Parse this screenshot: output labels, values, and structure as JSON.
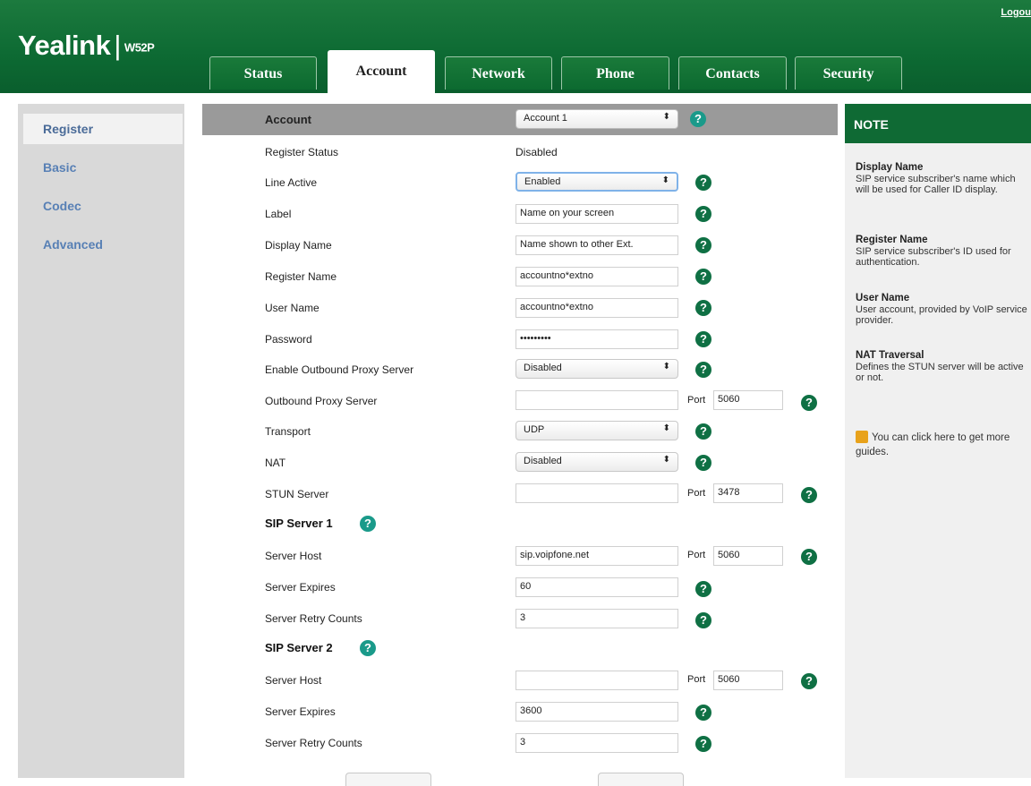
{
  "header": {
    "brand": "Yealink",
    "separator": "|",
    "model": "W52P",
    "logout": "Logou",
    "tabs": [
      {
        "label": "Status"
      },
      {
        "label": "Account"
      },
      {
        "label": "Network"
      },
      {
        "label": "Phone"
      },
      {
        "label": "Contacts"
      },
      {
        "label": "Security"
      }
    ],
    "active_tab": "Account"
  },
  "sidebar": {
    "items": [
      {
        "label": "Register"
      },
      {
        "label": "Basic"
      },
      {
        "label": "Codec"
      },
      {
        "label": "Advanced"
      }
    ],
    "active": "Register"
  },
  "form": {
    "account_label": "Account",
    "account_value": "Account 1",
    "register_status_label": "Register Status",
    "register_status_value": "Disabled",
    "line_active_label": "Line Active",
    "line_active_value": "Enabled",
    "label_label": "Label",
    "label_value": "Name on your screen",
    "display_name_label": "Display Name",
    "display_name_value": "Name shown to other Ext.",
    "register_name_label": "Register Name",
    "register_name_value": "accountno*extno",
    "user_name_label": "User Name",
    "user_name_value": "accountno*extno",
    "password_label": "Password",
    "password_value": "•••••••••",
    "outbound_enable_label": "Enable Outbound Proxy Server",
    "outbound_enable_value": "Disabled",
    "outbound_server_label": "Outbound Proxy Server",
    "outbound_server_value": "",
    "outbound_port": "5060",
    "transport_label": "Transport",
    "transport_value": "UDP",
    "nat_label": "NAT",
    "nat_value": "Disabled",
    "stun_label": "STUN Server",
    "stun_value": "",
    "stun_port": "3478",
    "port_label": "Port",
    "sip1": {
      "title": "SIP Server 1",
      "host_label": "Server Host",
      "host_value": "sip.voipfone.net",
      "port": "5060",
      "expires_label": "Server Expires",
      "expires_value": "60",
      "retry_label": "Server Retry Counts",
      "retry_value": "3"
    },
    "sip2": {
      "title": "SIP Server 2",
      "host_label": "Server Host",
      "host_value": "",
      "port": "5060",
      "expires_label": "Server Expires",
      "expires_value": "3600",
      "retry_label": "Server Retry Counts",
      "retry_value": "3"
    }
  },
  "note": {
    "header": "NOTE",
    "items": [
      {
        "title": "Display Name",
        "text": "SIP service subscriber's name which will be used for Caller ID display."
      },
      {
        "title": "Register Name",
        "text": "SIP service subscriber's ID used for authentication."
      },
      {
        "title": "User Name",
        "text": "User account, provided by VoIP service provider."
      },
      {
        "title": "NAT Traversal",
        "text": "Defines the STUN server will be active or not."
      }
    ],
    "guide": "You can click here to get more guides."
  },
  "icons": {
    "help": "question-mark-circle-icon",
    "caret": "select-arrows-icon",
    "guide": "guide-book-icon"
  },
  "colors": {
    "header_green": "#0d6a33",
    "help_icon": "#0f7044",
    "nav_text": "#5880b5"
  }
}
